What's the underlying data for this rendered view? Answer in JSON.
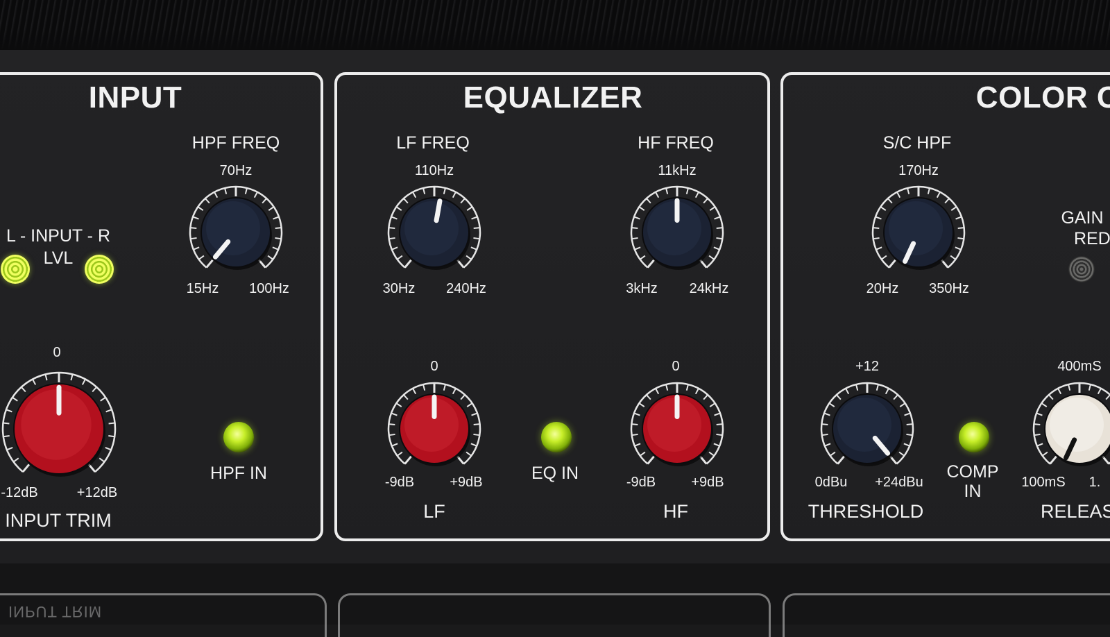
{
  "sections": {
    "input": {
      "title": "INPUT",
      "meter_label_line1": "L - INPUT - R",
      "meter_label_line2": "LVL",
      "hpf_freq": {
        "label": "HPF FREQ",
        "top": "70Hz",
        "min": "15Hz",
        "max": "100Hz"
      },
      "hpf_in_label": "HPF IN",
      "input_trim": {
        "label": "INPUT TRIM",
        "top": "0",
        "min": "-12dB",
        "max": "+12dB"
      }
    },
    "equalizer": {
      "title": "EQUALIZER",
      "lf_freq": {
        "label": "LF FREQ",
        "top": "110Hz",
        "min": "30Hz",
        "max": "240Hz"
      },
      "hf_freq": {
        "label": "HF FREQ",
        "top": "11kHz",
        "min": "3kHz",
        "max": "24kHz"
      },
      "lf": {
        "label": "LF",
        "top": "0",
        "min": "-9dB",
        "max": "+9dB"
      },
      "hf": {
        "label": "HF",
        "top": "0",
        "min": "-9dB",
        "max": "+9dB"
      },
      "eq_in_label": "EQ IN"
    },
    "color_comp": {
      "title": "COLOR C",
      "sc_hpf": {
        "label": "S/C HPF",
        "top": "170Hz",
        "min": "20Hz",
        "max": "350Hz"
      },
      "gain_reduction_line1": "GAIN",
      "gain_reduction_line2": "REDUCTIC",
      "threshold": {
        "label": "THRESHOLD",
        "top": "+12",
        "min": "0dBu",
        "max": "+24dBu"
      },
      "comp_in_line1": "COMP",
      "comp_in_line2": "IN",
      "release": {
        "label": "RELEASE",
        "top": "400mS",
        "min": "100mS",
        "max": "1."
      }
    }
  },
  "reflection_text": "INPUT TRIM",
  "colors": {
    "panel": "#1f1f21",
    "outline": "#ececec",
    "knob_navy": "#1b2233",
    "knob_red": "#b3101e",
    "knob_cream": "#e8e2d8",
    "led_green": "#c8ef2a"
  },
  "knobs": [
    {
      "id": "hpf-freq",
      "color": "navy",
      "pointer_angle": -140
    },
    {
      "id": "lf-freq",
      "color": "navy",
      "pointer_angle": 10
    },
    {
      "id": "hf-freq",
      "color": "navy",
      "pointer_angle": 0
    },
    {
      "id": "sc-hpf",
      "color": "navy",
      "pointer_angle": -155
    },
    {
      "id": "input-trim",
      "color": "red",
      "pointer_angle": 0
    },
    {
      "id": "lf-gain",
      "color": "red",
      "pointer_angle": 0
    },
    {
      "id": "hf-gain",
      "color": "red",
      "pointer_angle": 0
    },
    {
      "id": "threshold",
      "color": "navy",
      "pointer_angle": 140
    },
    {
      "id": "release",
      "color": "cream",
      "pointer_angle": -155
    }
  ]
}
